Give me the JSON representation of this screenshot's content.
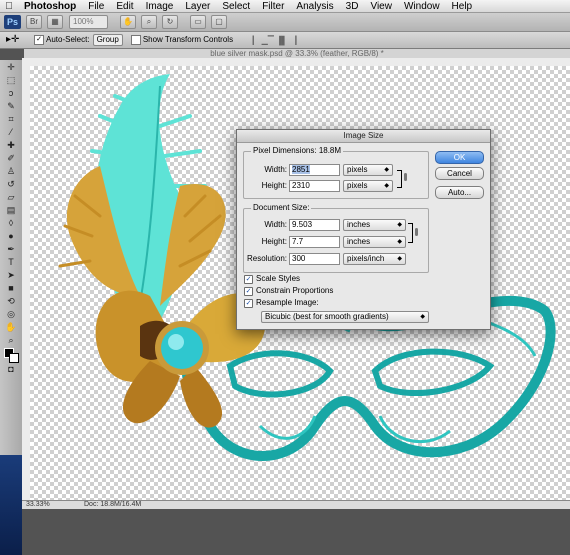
{
  "menubar": {
    "apple": "",
    "items": [
      "Photoshop",
      "File",
      "Edit",
      "Image",
      "Layer",
      "Select",
      "Filter",
      "Analysis",
      "3D",
      "View",
      "Window",
      "Help"
    ]
  },
  "appbar": {
    "logo": "Ps",
    "zoom": "100%"
  },
  "options": {
    "auto_select_label": "Auto-Select:",
    "auto_select_value": "Group",
    "show_transform_label": "Show Transform Controls"
  },
  "document": {
    "tab_title": "blue silver mask.psd @ 33.3% (feather, RGB/8) *"
  },
  "status": {
    "zoom": "33.33%",
    "doc": "Doc: 18.8M/16.4M"
  },
  "dialog": {
    "title": "Image Size",
    "pixel_dimensions_label": "Pixel Dimensions:",
    "pixel_dimensions_value": "18.8M",
    "width_label": "Width:",
    "height_label": "Height:",
    "pixel_width": "2851",
    "pixel_height": "2310",
    "pixel_unit": "pixels",
    "document_size_label": "Document Size:",
    "doc_width": "9.503",
    "doc_height": "7.7",
    "doc_unit": "inches",
    "resolution_label": "Resolution:",
    "resolution": "300",
    "resolution_unit": "pixels/inch",
    "scale_styles": "Scale Styles",
    "constrain": "Constrain Proportions",
    "resample": "Resample Image:",
    "resample_method": "Bicubic (best for smooth gradients)",
    "ok": "OK",
    "cancel": "Cancel",
    "auto": "Auto..."
  }
}
